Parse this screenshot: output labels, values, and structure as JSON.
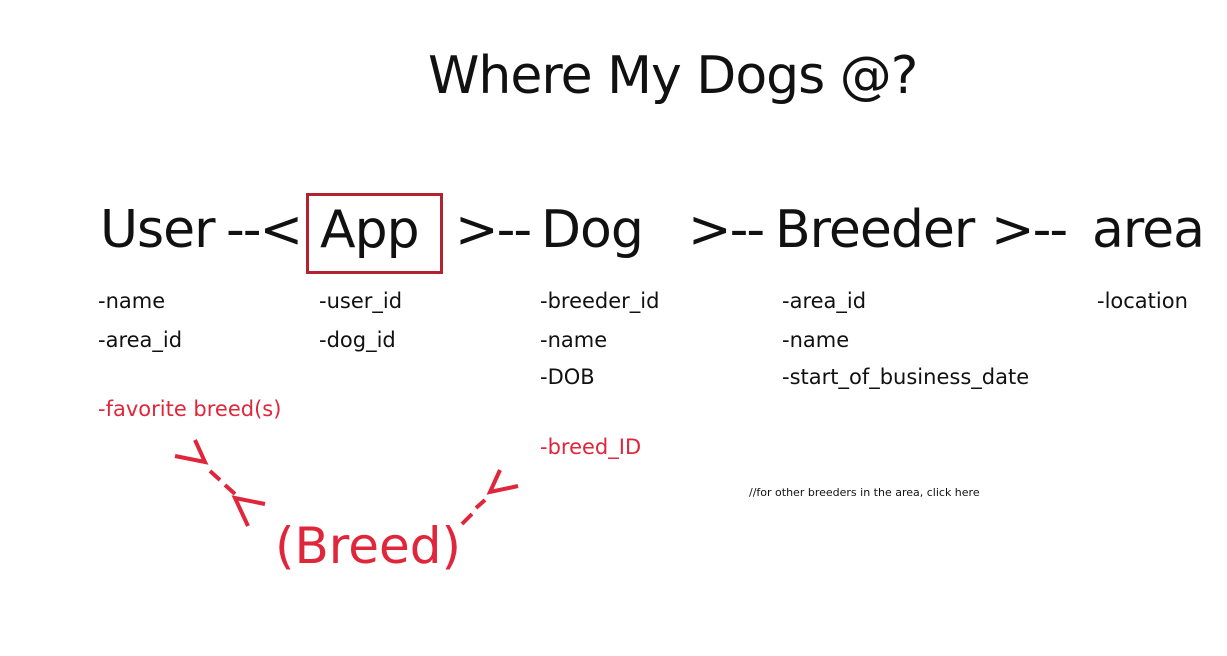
{
  "title": "Where My Dogs @?",
  "entities": {
    "user": "User",
    "app": "App",
    "dog": "Dog",
    "breeder": "Breeder",
    "area": "area",
    "breed": "(Breed)"
  },
  "relations": {
    "user_app": "--<",
    "app_dog": ">--",
    "dog_breeder": ">--",
    "breeder_area": ">--"
  },
  "fields": {
    "user": [
      "-name",
      "-area_id"
    ],
    "user_extra": "-favorite breed(s)",
    "app": [
      "-user_id",
      "-dog_id"
    ],
    "dog": [
      "-breeder_id",
      "-name",
      "-DOB"
    ],
    "dog_extra": "-breed_ID",
    "breeder": [
      "-area_id",
      "-name",
      "-start_of_business_date"
    ],
    "area": [
      "-location"
    ]
  },
  "note": "//for other breeders in the area, click here",
  "colors": {
    "text": "#111111",
    "accent_red": "#e0263a",
    "box_border": "#b3222f"
  }
}
